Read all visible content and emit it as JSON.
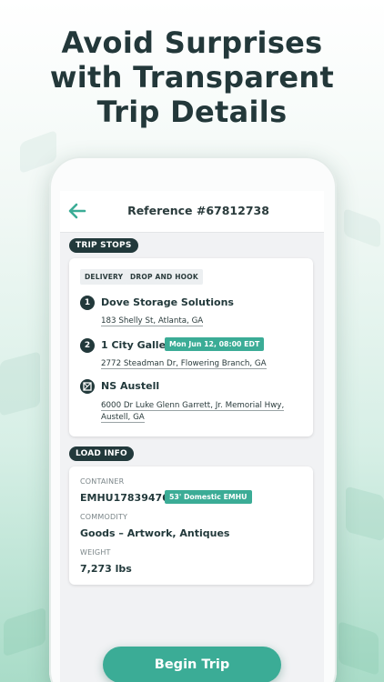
{
  "headline": {
    "line1": "Avoid Surprises",
    "line2": "with Transparent",
    "line3": "Trip Details"
  },
  "header": {
    "back_icon": "arrow-left-icon",
    "title": "Reference #67812738"
  },
  "trip_stops": {
    "section_label": "TRIP STOPS",
    "tags": [
      "DELIVERY",
      "DROP AND HOOK"
    ],
    "stops": [
      {
        "marker": "1",
        "name": "Dove Storage Solutions",
        "address_line1": "183 Shelly St, Atlanta, GA",
        "address_line2": ""
      },
      {
        "marker": "2",
        "name": "1 City Gallery",
        "badge": "Mon Jun 12, 08:00 EDT",
        "address_line1": "2772 Steadman Dr, Flowering Branch, GA",
        "address_line2": ""
      },
      {
        "marker_icon": "yard-icon",
        "name": "NS Austell",
        "address_line1": "6000 Dr Luke Glenn Garrett, Jr. Memorial Hwy,",
        "address_line2": "Austell, GA"
      }
    ]
  },
  "load_info": {
    "section_label": "LOAD INFO",
    "container_label": "CONTAINER",
    "container_value": "EMHU178394768",
    "container_badge": "53' Domestic EMHU",
    "commodity_label": "COMMODITY",
    "commodity_value": "Goods – Artwork, Antiques",
    "weight_label": "WEIGHT",
    "weight_value": "7,273 lbs"
  },
  "actions": {
    "begin_label": "Begin Trip"
  },
  "colors": {
    "accent": "#3bac96",
    "dark": "#22393b",
    "headline": "#23383a"
  }
}
